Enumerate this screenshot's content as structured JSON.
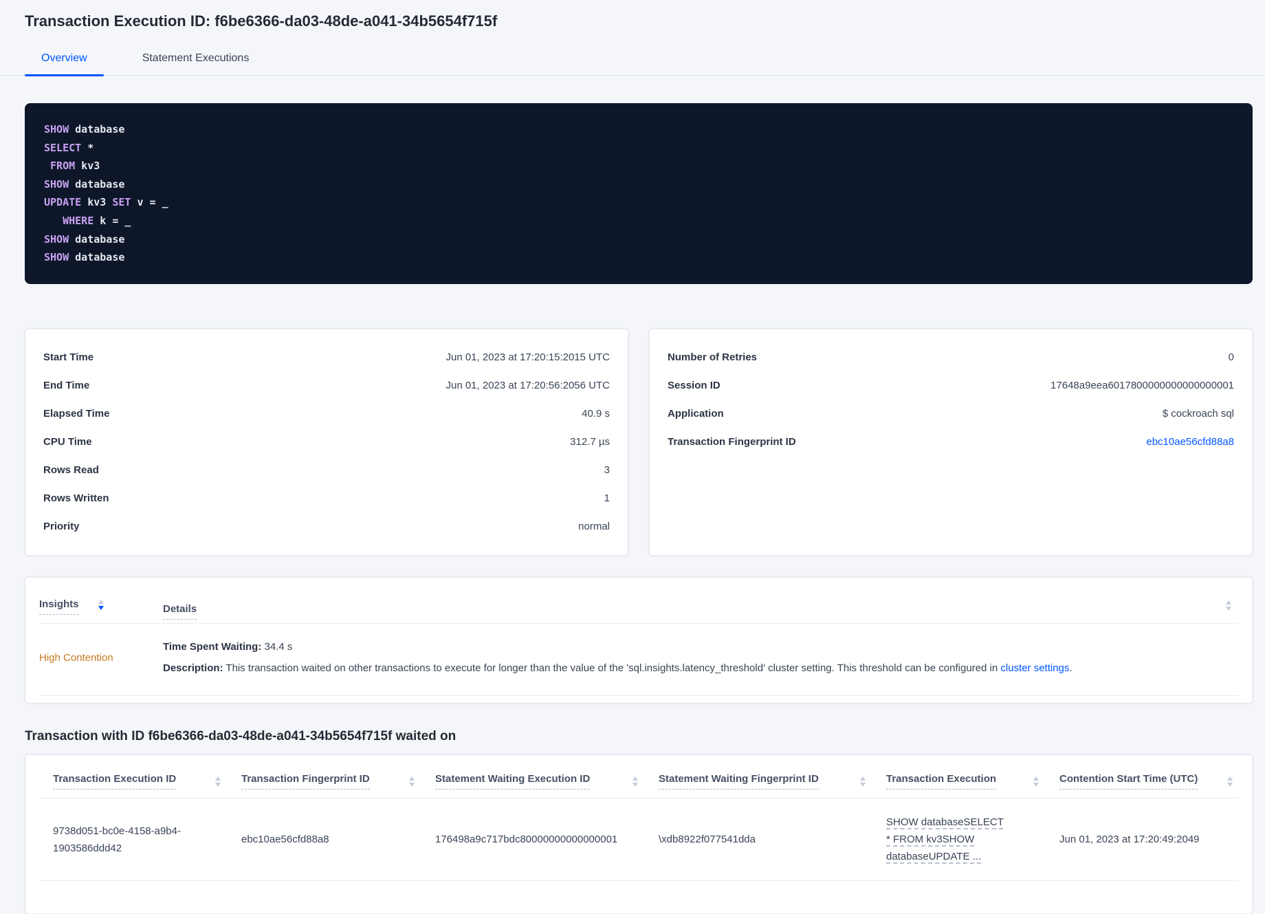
{
  "header": {
    "title": "Transaction Execution ID: f6be6366-da03-48de-a041-34b5654f715f",
    "tabs": [
      {
        "label": "Overview",
        "active": true
      },
      {
        "label": "Statement Executions",
        "active": false
      }
    ]
  },
  "sql": {
    "lines": [
      {
        "segments": [
          {
            "text": "SHOW"
          },
          {
            "text": " database"
          }
        ]
      },
      {
        "segments": [
          {
            "text": "SELECT"
          },
          {
            "text": " *"
          }
        ]
      },
      {
        "segments": [
          {
            "text": " "
          },
          {
            "text": "FROM"
          },
          {
            "text": " kv3"
          }
        ]
      },
      {
        "segments": [
          {
            "text": "SHOW"
          },
          {
            "text": " database"
          }
        ]
      },
      {
        "segments": [
          {
            "text": "UPDATE"
          },
          {
            "text": " kv3 "
          },
          {
            "text": "SET"
          },
          {
            "text": " v = _"
          }
        ]
      },
      {
        "segments": [
          {
            "text": "   "
          },
          {
            "text": "WHERE"
          },
          {
            "text": " k = _"
          }
        ]
      },
      {
        "segments": [
          {
            "text": "SHOW"
          },
          {
            "text": " database"
          }
        ]
      },
      {
        "segments": [
          {
            "text": "SHOW"
          },
          {
            "text": " database"
          }
        ]
      }
    ]
  },
  "details_left": {
    "rows": [
      {
        "label": "Start Time",
        "value": "Jun 01, 2023 at 17:20:15:2015 UTC"
      },
      {
        "label": "End Time",
        "value": "Jun 01, 2023 at 17:20:56:2056 UTC"
      },
      {
        "label": "Elapsed Time",
        "value": "40.9 s"
      },
      {
        "label": "CPU Time",
        "value": "312.7 µs"
      },
      {
        "label": "Rows Read",
        "value": "3"
      },
      {
        "label": "Rows Written",
        "value": "1"
      },
      {
        "label": "Priority",
        "value": "normal"
      }
    ]
  },
  "details_right": {
    "rows": [
      {
        "label": "Number of Retries",
        "value": "0"
      },
      {
        "label": "Session ID",
        "value": "17648a9eea6017800000000000000001"
      },
      {
        "label": "Application",
        "value": "$ cockroach sql"
      },
      {
        "label": "Transaction Fingerprint ID",
        "value": "ebc10ae56cfd88a8"
      }
    ]
  },
  "insights": {
    "columns": [
      {
        "label": "Insights"
      },
      {
        "label": "Details"
      }
    ],
    "row": {
      "insight": "High Contention",
      "waiting_label": "Time Spent Waiting:",
      "waiting_value": " 34.4 s",
      "description_label": "Description:",
      "description_text": " This transaction waited on other transactions to execute for longer than the value of the 'sql.insights.latency_threshold' cluster setting. This threshold can be configured in ",
      "link_text": "cluster settings",
      "after_link": "."
    }
  },
  "waited_on": {
    "heading": "Transaction with ID f6be6366-da03-48de-a041-34b5654f715f waited on",
    "columns": [
      {
        "label": "Transaction Execution ID"
      },
      {
        "label": "Transaction Fingerprint ID"
      },
      {
        "label": "Statement Waiting Execution ID"
      },
      {
        "label": "Statement Waiting Fingerprint ID"
      },
      {
        "label": "Transaction Execution"
      },
      {
        "label": "Contention Start Time (UTC)"
      }
    ],
    "row": {
      "txn_execution_id": "9738d051-bc0e-4158-a9b4-1903586ddd42",
      "txn_fingerprint_id": "ebc10ae56cfd88a8",
      "stmt_waiting_execution_id": "176498a9c717bdc80000000000000001",
      "stmt_waiting_fingerprint_id": "\\xdb8922f077541dda",
      "txn_execution": "SHOW databaseSELECT * FROM kv3SHOW databaseUPDATE ...",
      "contention_start": "Jun 01, 2023 at 17:20:49:2049"
    }
  },
  "colors": {
    "accent_blue": "#0055ff",
    "warning_orange": "#c6781e",
    "code_background": "#0e1729",
    "code_keyword": "#c7a1f2",
    "page_background": "#f4f6fa"
  }
}
